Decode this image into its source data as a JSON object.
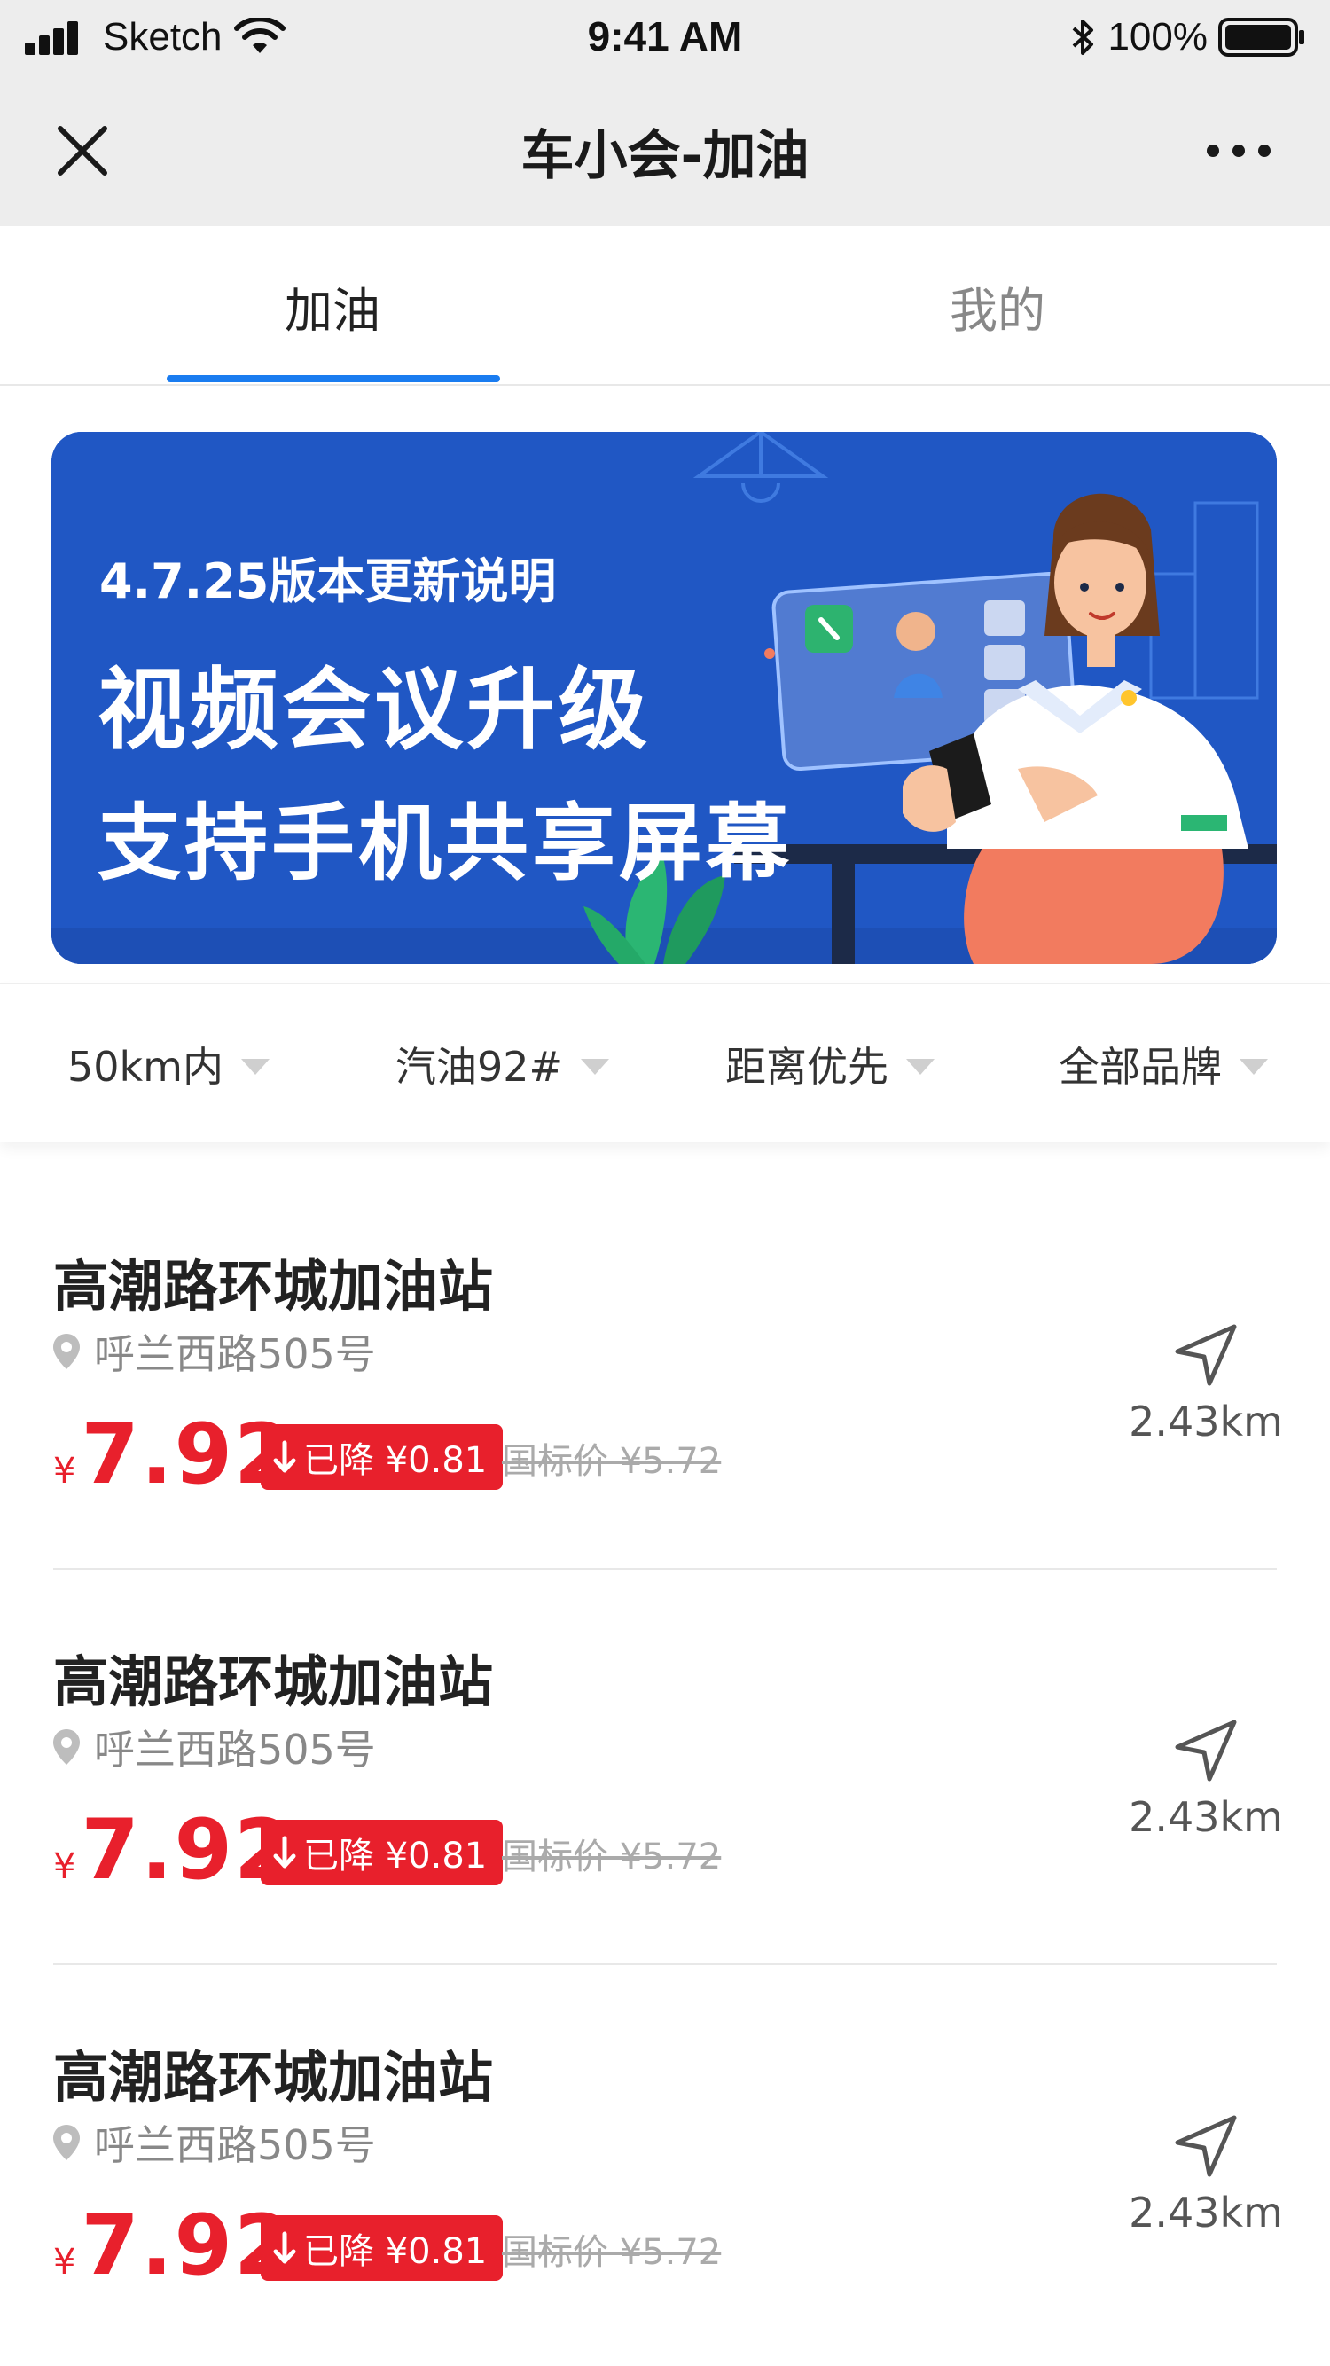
{
  "status_bar": {
    "carrier": "Sketch",
    "time": "9:41 AM",
    "battery": "100%",
    "icons": [
      "signal-icon",
      "wifi-icon",
      "bluetooth-icon",
      "battery-icon"
    ]
  },
  "nav": {
    "title": "车小会-加油",
    "close_icon": "close-icon",
    "more_icon": "more-icon"
  },
  "tabs": [
    {
      "label": "加油",
      "active": true
    },
    {
      "label": "我的",
      "active": false
    }
  ],
  "banner": {
    "subtitle": "4.7.25版本更新说明",
    "line1": "视频会议升级",
    "line2": "支持手机共享屏幕"
  },
  "filters": [
    {
      "label": "50km内"
    },
    {
      "label": "汽油92#"
    },
    {
      "label": "距离优先"
    },
    {
      "label": "全部品牌"
    }
  ],
  "stations": [
    {
      "name": "高潮路环城加油站",
      "address": "呼兰西路505号",
      "currency": "¥",
      "price": "7.92",
      "drop": "已降 ¥0.81",
      "original": "国标价 ¥5.72",
      "distance": "2.43km"
    },
    {
      "name": "高潮路环城加油站",
      "address": "呼兰西路505号",
      "currency": "¥",
      "price": "7.92",
      "drop": "已降 ¥0.81",
      "original": "国标价 ¥5.72",
      "distance": "2.43km"
    },
    {
      "name": "高潮路环城加油站",
      "address": "呼兰西路505号",
      "currency": "¥",
      "price": "7.92",
      "drop": "已降 ¥0.81",
      "original": "国标价 ¥5.72",
      "distance": "2.43km"
    }
  ],
  "colors": {
    "accent": "#1a7cf0",
    "price_red": "#e8202c",
    "banner_blue": "#2057c4",
    "header_gray": "#ededed"
  }
}
